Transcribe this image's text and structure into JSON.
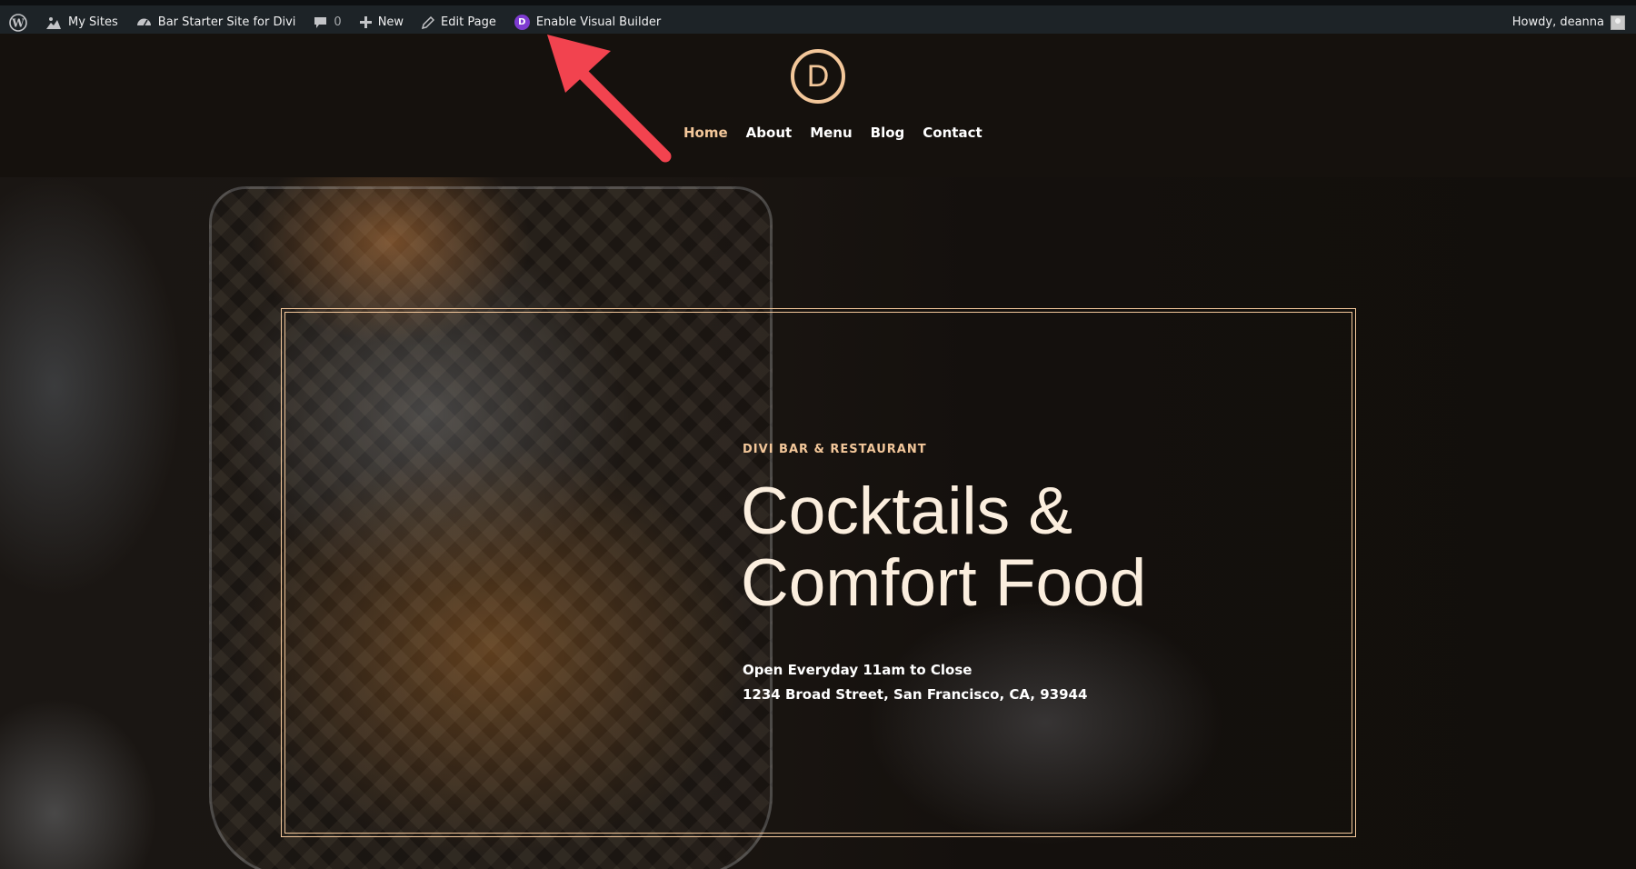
{
  "admin_bar": {
    "wp_logo_icon": "wordpress-icon",
    "my_sites": "My Sites",
    "site_name": "Bar Starter Site for Divi",
    "comments_count": "0",
    "new_label": "New",
    "edit_page": "Edit Page",
    "visual_builder": "Enable Visual Builder",
    "divi_badge": "D",
    "howdy": "Howdy, deanna"
  },
  "header": {
    "logo_letter": "D",
    "nav": [
      {
        "label": "Home",
        "active": true
      },
      {
        "label": "About"
      },
      {
        "label": "Menu"
      },
      {
        "label": "Blog"
      },
      {
        "label": "Contact"
      }
    ]
  },
  "hero": {
    "eyebrow": "DIVI BAR & RESTAURANT",
    "headline_line1": "Cocktails &",
    "headline_line2": "Comfort Food",
    "hours": "Open Everyday 11am to Close",
    "address": "1234 Broad Street, San Francisco, CA, 93944"
  },
  "colors": {
    "accent": "#f3c79a",
    "admin_bar_bg": "#1d2327",
    "page_bg": "#15110d",
    "annotation_arrow": "#f2434f"
  }
}
